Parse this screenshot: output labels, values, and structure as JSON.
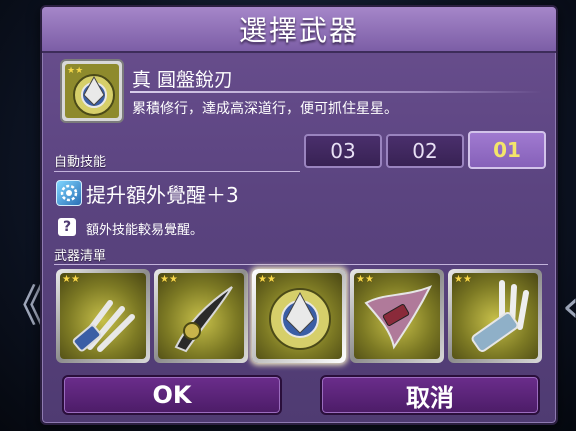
{
  "dialog": {
    "title": "選擇武器"
  },
  "weapon": {
    "name": "真 圓盤銳刃",
    "description": "累積修行，達成高深道行，便可抓住星星。"
  },
  "auto_skill": {
    "label": "自動技能",
    "tabs": [
      {
        "label": "03",
        "active": false
      },
      {
        "label": "02",
        "active": false
      },
      {
        "label": "01",
        "active": true
      }
    ],
    "skill_name": "提升額外覺醒＋3",
    "skill_description": "額外技能較易覺醒。"
  },
  "weapon_list": {
    "label": "武器清單",
    "items": [
      {
        "icon": "trident-claw-icon",
        "selected": false
      },
      {
        "icon": "curved-blade-icon",
        "selected": false
      },
      {
        "icon": "disc-blade-icon",
        "selected": true
      },
      {
        "icon": "winged-blade-icon",
        "selected": false
      },
      {
        "icon": "fork-claw-icon",
        "selected": false
      }
    ]
  },
  "buttons": {
    "ok": "OK",
    "cancel": "取消"
  },
  "nav": {
    "left_arrow": "《",
    "right_arrow": "‹"
  },
  "colors": {
    "dialog_purple": "#5b4480",
    "title_purple": "#a586c9",
    "active_tab_text": "#f3e56a",
    "button_purple": "#5a2479"
  }
}
